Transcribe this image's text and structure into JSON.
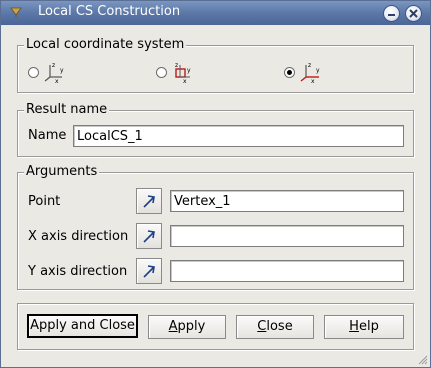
{
  "window": {
    "title": "Local CS Construction"
  },
  "local_cs": {
    "title": "Local coordinate system",
    "options": [
      {
        "icon": "cs-from-plane-icon",
        "checked": false
      },
      {
        "icon": "cs-from-shape-icon",
        "checked": false
      },
      {
        "icon": "cs-from-points-icon",
        "checked": true
      }
    ]
  },
  "result": {
    "title": "Result name",
    "name_label": "Name",
    "name_value": "LocalCS_1"
  },
  "arguments": {
    "title": "Arguments",
    "point_label": "Point",
    "point_value": "Vertex_1",
    "x_axis_label": "X axis direction",
    "x_axis_value": "",
    "y_axis_label": "Y axis direction",
    "y_axis_value": ""
  },
  "buttons": {
    "apply_close": "Apply and Close",
    "apply_first": "A",
    "apply_rest": "pply",
    "close_first": "C",
    "close_rest": "lose",
    "help_first": "H",
    "help_rest": "elp"
  }
}
